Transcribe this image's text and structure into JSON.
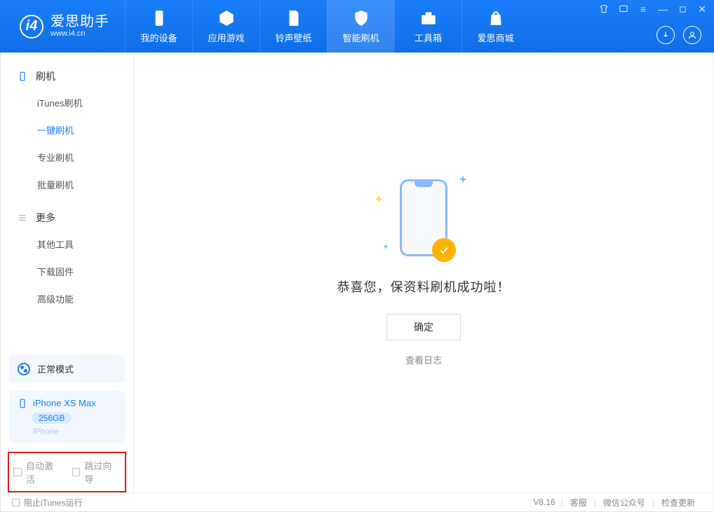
{
  "app": {
    "logo_title": "爱思助手",
    "logo_sub": "www.i4.cn",
    "version": "V8.16"
  },
  "main_tabs": [
    {
      "label": "我的设备"
    },
    {
      "label": "应用游戏"
    },
    {
      "label": "铃声壁纸"
    },
    {
      "label": "智能刷机"
    },
    {
      "label": "工具箱"
    },
    {
      "label": "爱思商城"
    }
  ],
  "sidebar": {
    "group1_title": "刷机",
    "group1_items": [
      "iTunes刷机",
      "一键刷机",
      "专业刷机",
      "批量刷机"
    ],
    "group2_title": "更多",
    "group2_items": [
      "其他工具",
      "下载固件",
      "高级功能"
    ],
    "mode_label": "正常模式",
    "device_name": "iPhone XS Max",
    "device_storage": "256GB",
    "device_type": "iPhone",
    "auto_activate": "自动激活",
    "skip_guide": "跳过向导"
  },
  "content": {
    "success_text": "恭喜您，保资料刷机成功啦！",
    "ok_button": "确定",
    "view_log": "查看日志"
  },
  "footer": {
    "block_itunes": "阻止iTunes运行",
    "links": [
      "客服",
      "微信公众号",
      "检查更新"
    ]
  }
}
